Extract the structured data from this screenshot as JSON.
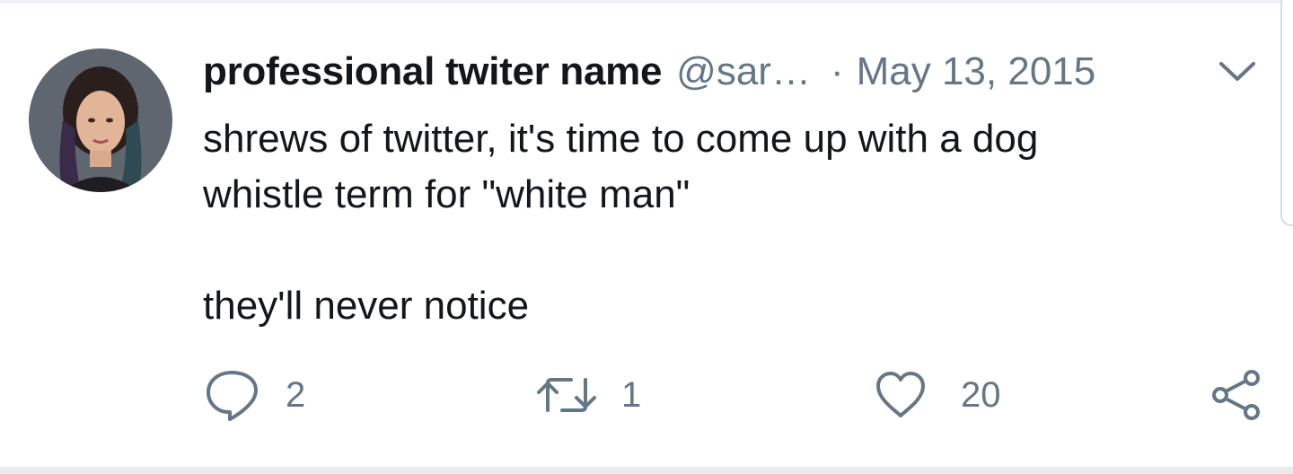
{
  "tweet": {
    "display_name": "professional twiter name",
    "handle": "@sar…",
    "separator": "·",
    "date": "May 13, 2015",
    "text_lines": [
      "shrews of twitter, it's time to come up with a dog",
      "whistle term for \"white man\"",
      "they'll never notice"
    ]
  },
  "actions": {
    "reply_count": "2",
    "retweet_count": "1",
    "like_count": "20"
  },
  "icons": {
    "reply": "speech-bubble-icon",
    "retweet": "retweet-arrows-icon",
    "like": "heart-icon",
    "share": "share-nodes-icon",
    "menu": "chevron-down-icon"
  },
  "colors": {
    "text": "#14171a",
    "secondary": "#657786",
    "divider": "#e8ecef"
  }
}
